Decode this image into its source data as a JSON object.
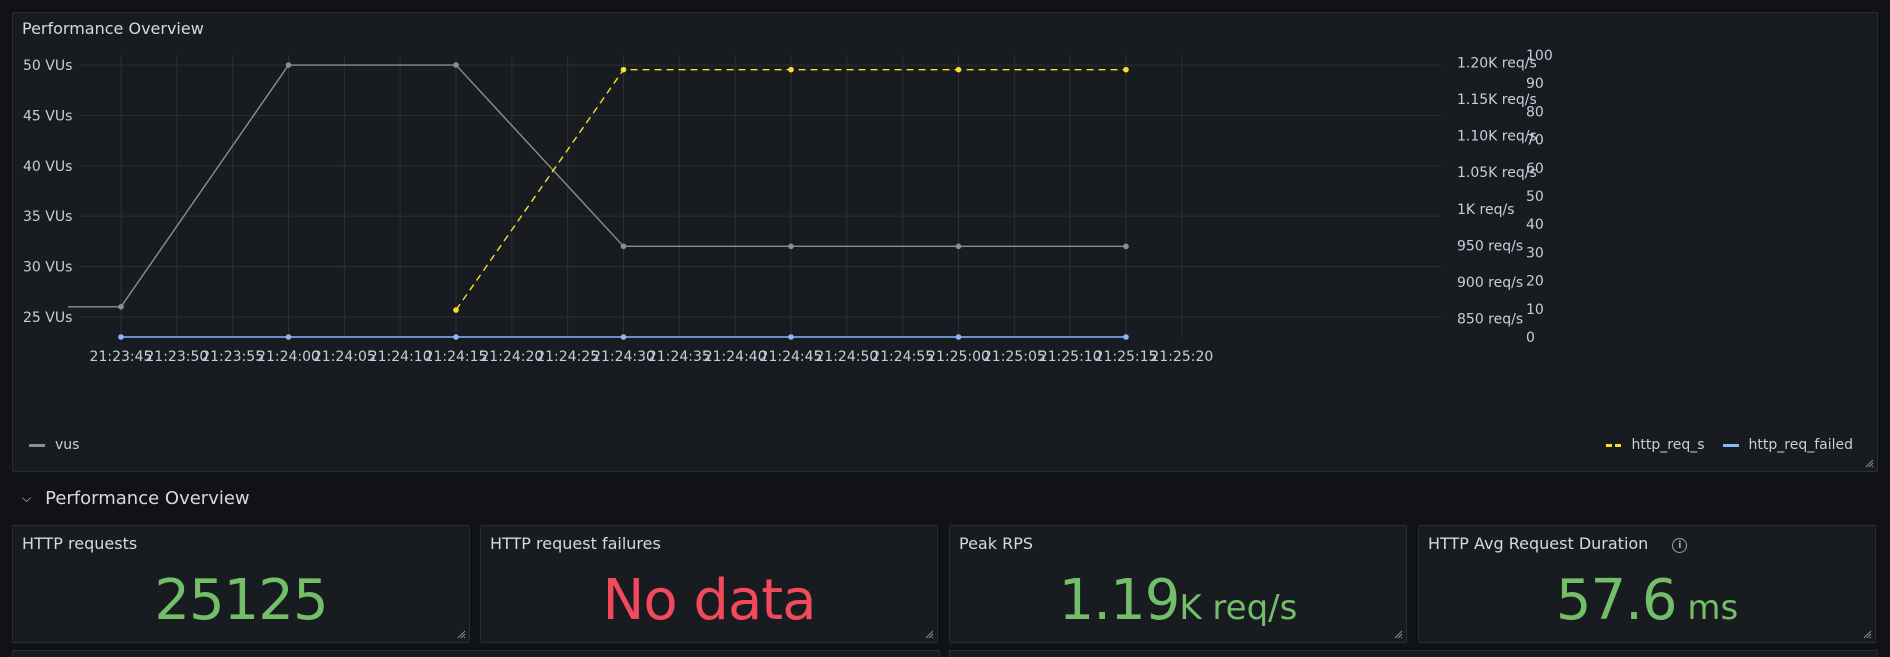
{
  "chart_panel": {
    "title": "Performance Overview",
    "legend": {
      "left": [
        {
          "name": "vus",
          "color": "#8e8e8e",
          "style": "solid"
        }
      ],
      "right": [
        {
          "name": "http_req_s",
          "color": "#fade2a",
          "style": "dashed"
        },
        {
          "name": "http_req_failed",
          "color": "#8ab8ff",
          "style": "solid"
        }
      ]
    }
  },
  "chart_data": {
    "type": "line",
    "x_ticks": [
      "21:23:45",
      "21:23:50",
      "21:23:55",
      "21:24:00",
      "21:24:05",
      "21:24:10",
      "21:24:15",
      "21:24:20",
      "21:24:25",
      "21:24:30",
      "21:24:35",
      "21:24:40",
      "21:24:45",
      "21:24:50",
      "21:24:55",
      "21:25:00",
      "21:25:05",
      "21:25:10",
      "21:25:15",
      "21:25:20"
    ],
    "x_range_seconds_from": "21:23:45",
    "left_axis": {
      "label": "",
      "ticks": [
        "25 VUs",
        "30 VUs",
        "35 VUs",
        "40 VUs",
        "45 VUs",
        "50 VUs"
      ],
      "ylim": [
        23,
        51
      ]
    },
    "right_axis_1": {
      "ticks": [
        "850 req/s",
        "900 req/s",
        "950 req/s",
        "1K req/s",
        "1.05K req/s",
        "1.10K req/s",
        "1.15K req/s",
        "1.20K req/s"
      ],
      "ylim": [
        825,
        1210
      ]
    },
    "right_axis_2": {
      "ticks": [
        "0",
        "10",
        "20",
        "30",
        "40",
        "50",
        "60",
        "70",
        "80",
        "90",
        "100"
      ],
      "ylim": [
        0,
        100
      ]
    },
    "series": [
      {
        "name": "vus",
        "axis": "left",
        "color": "#8e8e8e",
        "x": [
          "21:23:41",
          "21:23:45",
          "21:24:00",
          "21:24:15",
          "21:24:30",
          "21:24:45",
          "21:25:00",
          "21:25:15"
        ],
        "y": [
          26,
          26,
          50,
          50,
          32,
          32,
          32,
          32
        ]
      },
      {
        "name": "http_req_s",
        "axis": "right_1",
        "color": "#fade2a",
        "x": [
          "21:24:15",
          "21:24:30",
          "21:24:45",
          "21:25:00",
          "21:25:15"
        ],
        "y": [
          825,
          1190,
          1190,
          1190,
          1190
        ]
      },
      {
        "name": "http_req_failed",
        "axis": "right_2",
        "color": "#8ab8ff",
        "x": [
          "21:23:45",
          "21:24:00",
          "21:24:15",
          "21:24:30",
          "21:24:45",
          "21:25:00",
          "21:25:15"
        ],
        "y": [
          0,
          0,
          0,
          0,
          0,
          0,
          0
        ]
      }
    ],
    "grid": true
  },
  "section": {
    "title": "Performance Overview"
  },
  "stats": [
    {
      "title": "HTTP requests",
      "value": "25125",
      "unit": "",
      "color": "#73bf69"
    },
    {
      "title": "HTTP request failures",
      "value": "No data",
      "unit": "",
      "color": "#f2495c"
    },
    {
      "title": "Peak RPS",
      "value": "1.19",
      "unit": "K req/s",
      "color": "#73bf69"
    },
    {
      "title": "HTTP Avg Request Duration",
      "value": "57.6",
      "unit": " ms",
      "color": "#73bf69",
      "info_icon": "info-icon"
    }
  ]
}
